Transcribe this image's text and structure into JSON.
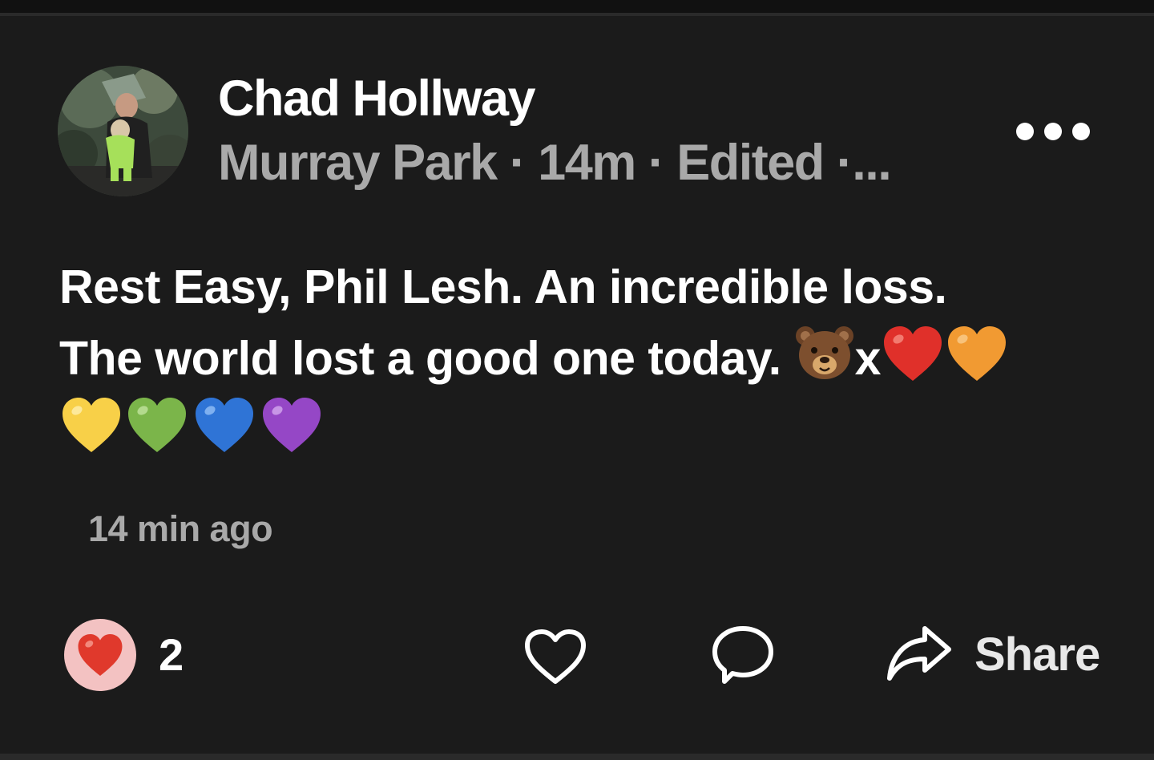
{
  "post": {
    "author": "Chad Hollway",
    "meta": "Murray Park · 14m · Edited ·...",
    "text_line1": "Rest Easy, Phil Lesh. An incredible loss.",
    "text_line2": "The world lost a good one today.",
    "text_x": "x",
    "timestamp": "14 min ago"
  },
  "reactions": {
    "count": "2",
    "type": "heart"
  },
  "actions": {
    "like_icon": "heart-outline-icon",
    "comment_icon": "comment-bubble-icon",
    "share_icon": "share-arrow-icon",
    "share_label": "Share"
  },
  "emojis": [
    "bear-face",
    "red-heart",
    "orange-heart",
    "yellow-heart",
    "green-heart",
    "blue-heart",
    "purple-heart"
  ],
  "colors": {
    "background": "#1b1b1b",
    "text_primary": "#ffffff",
    "text_secondary": "#a9a9a9",
    "heart_red": "#e0302a",
    "heart_orange": "#f19a32",
    "heart_yellow": "#f8d048",
    "heart_green": "#7bb54a",
    "heart_blue": "#2f74d6",
    "heart_purple": "#9547c6",
    "reaction_badge": "#f3c2c2"
  }
}
